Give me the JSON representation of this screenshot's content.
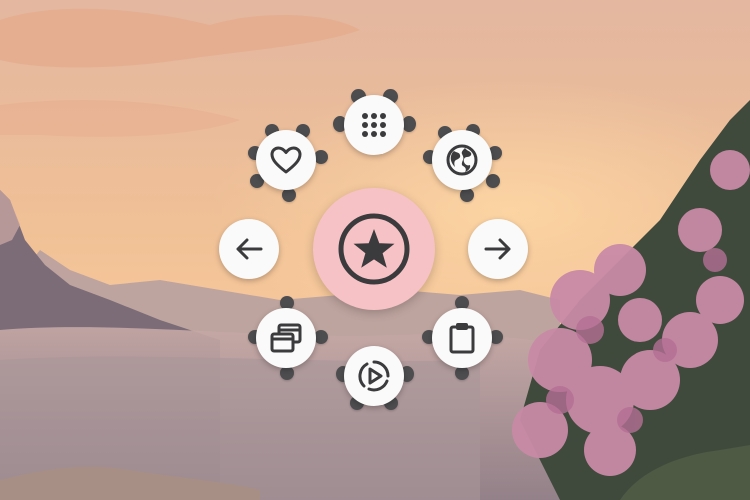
{
  "wallpaper": {
    "sky_top": "#e7b99b",
    "sky_glow": "#f6c08a",
    "mountain_color": "#8a7884",
    "blossom_color": "#c98aa6",
    "foliage_color": "#3f4a3c"
  },
  "pie_menu": {
    "center": {
      "icon": "star-circle-icon",
      "fill": "#f6c2c6"
    },
    "items": [
      {
        "name": "apps",
        "icon": "apps-grid-icon"
      },
      {
        "name": "favorite",
        "icon": "heart-icon"
      },
      {
        "name": "browser",
        "icon": "globe-icon"
      },
      {
        "name": "back",
        "icon": "arrow-left-icon"
      },
      {
        "name": "forward",
        "icon": "arrow-right-icon"
      },
      {
        "name": "switch-windows",
        "icon": "window-stack-icon"
      },
      {
        "name": "clipboard",
        "icon": "clipboard-icon"
      },
      {
        "name": "media",
        "icon": "play-circle-icon"
      }
    ],
    "nub_color": "#4d4d4f",
    "icon_color": "#3b3b3d"
  }
}
